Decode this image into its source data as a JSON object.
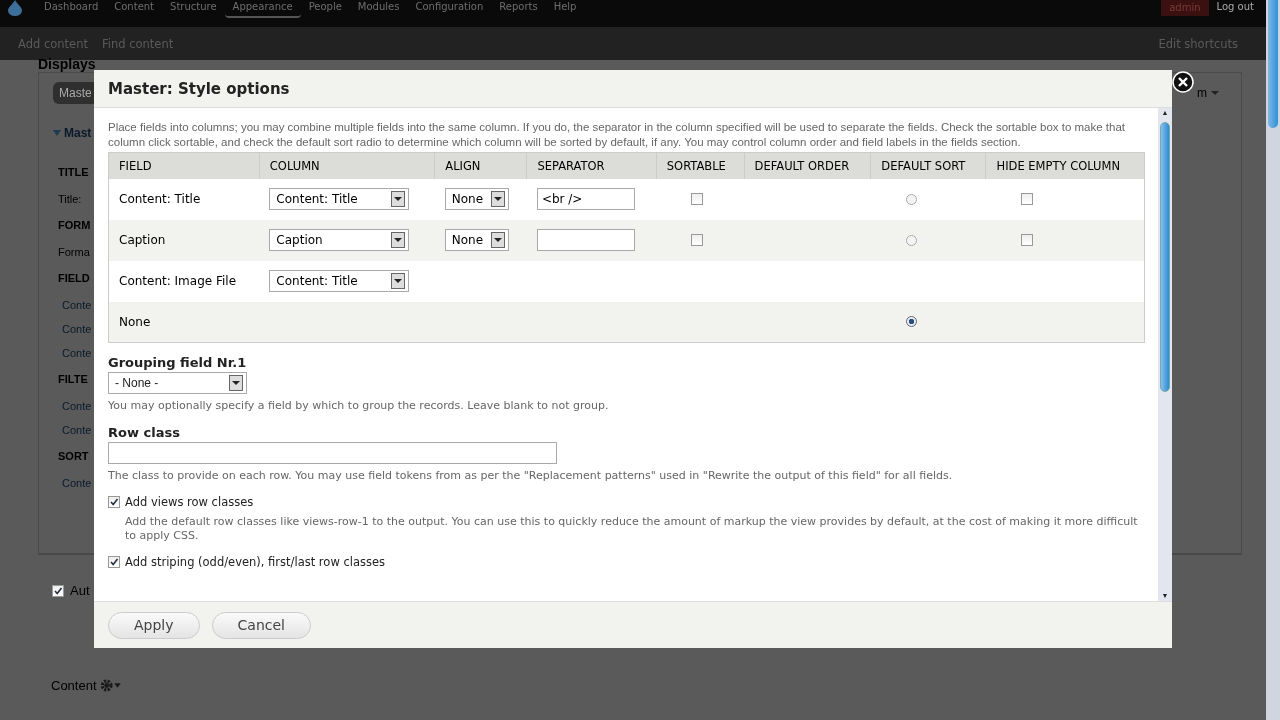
{
  "toolbar": {
    "menu": [
      {
        "label": "Dashboard",
        "selected": false
      },
      {
        "label": "Content",
        "selected": false
      },
      {
        "label": "Structure",
        "selected": false
      },
      {
        "label": "Appearance",
        "selected": true
      },
      {
        "label": "People",
        "selected": false
      },
      {
        "label": "Modules",
        "selected": false
      },
      {
        "label": "Configuration",
        "selected": false
      },
      {
        "label": "Reports",
        "selected": false
      },
      {
        "label": "Help",
        "selected": false
      }
    ],
    "user": "admin",
    "logout": "Log out"
  },
  "shortcuts": {
    "items": [
      "Add content",
      "Find content"
    ],
    "edit": "Edit shortcuts"
  },
  "background": {
    "heading": "Displays",
    "tab": "Maste",
    "section": "Mast",
    "dropdown": "m",
    "items": [
      {
        "kind": "heading",
        "text": "TITLE"
      },
      {
        "kind": "value",
        "text": "Title:"
      },
      {
        "kind": "heading",
        "text": "FORM"
      },
      {
        "kind": "value",
        "text": "Forma"
      },
      {
        "kind": "heading",
        "text": "FIELD"
      },
      {
        "kind": "link",
        "text": "Conte"
      },
      {
        "kind": "link",
        "text": "Conte"
      },
      {
        "kind": "link",
        "text": "Conte"
      },
      {
        "kind": "heading",
        "text": "FILTE"
      },
      {
        "kind": "link",
        "text": "Conte"
      },
      {
        "kind": "link",
        "text": "Conte"
      },
      {
        "kind": "heading",
        "text": "SORT"
      },
      {
        "kind": "link",
        "text": "Conte"
      }
    ],
    "auto": {
      "label": "Aut",
      "checked": true
    },
    "footer_label": "Content"
  },
  "dialog": {
    "title": "Master: Style options",
    "description": "Place fields into columns; you may combine multiple fields into the same column. If you do, the separator in the column specified will be used to separate the fields. Check the sortable box to make that column click sortable, and check the default sort radio to determine which column will be sorted by default, if any. You may control column order and field labels in the fields section.",
    "table": {
      "columns": [
        "FIELD",
        "COLUMN",
        "ALIGN",
        "SEPARATOR",
        "SORTABLE",
        "DEFAULT ORDER",
        "DEFAULT SORT",
        "HIDE EMPTY COLUMN"
      ],
      "rows": [
        {
          "field": "Content: Title",
          "column": "Content: Title",
          "align": "None",
          "separator": "<br />",
          "sortable": false,
          "default_sort": {
            "selected": false
          },
          "hide_empty": false
        },
        {
          "field": "Caption",
          "column": "Caption",
          "align": "None",
          "separator": "",
          "sortable": false,
          "default_sort": {
            "selected": false
          },
          "hide_empty": false
        },
        {
          "field": "Content: Image File",
          "column": "Content: Title"
        },
        {
          "field": "None",
          "default_sort": {
            "selected": true
          }
        }
      ]
    },
    "grouping": {
      "label": "Grouping field Nr.1",
      "value": "- None -",
      "help": "You may optionally specify a field by which to group the records. Leave blank to not group."
    },
    "row_class": {
      "label": "Row class",
      "help": "The class to provide on each row. You may use field tokens from as per the \"Replacement patterns\" used in \"Rewrite the output of this field\" for all fields."
    },
    "options": [
      {
        "label": "Add views row classes",
        "checked": true,
        "help": "Add the default row classes like views-row-1 to the output. You can use this to quickly reduce the amount of markup the view provides by default, at the cost of making it more difficult to apply CSS."
      },
      {
        "label": "Add striping (odd/even), first/last row classes",
        "checked": true
      }
    ],
    "scroll_arrows": [
      "▲",
      "▼"
    ],
    "buttons": [
      "Apply",
      "Cancel"
    ]
  }
}
